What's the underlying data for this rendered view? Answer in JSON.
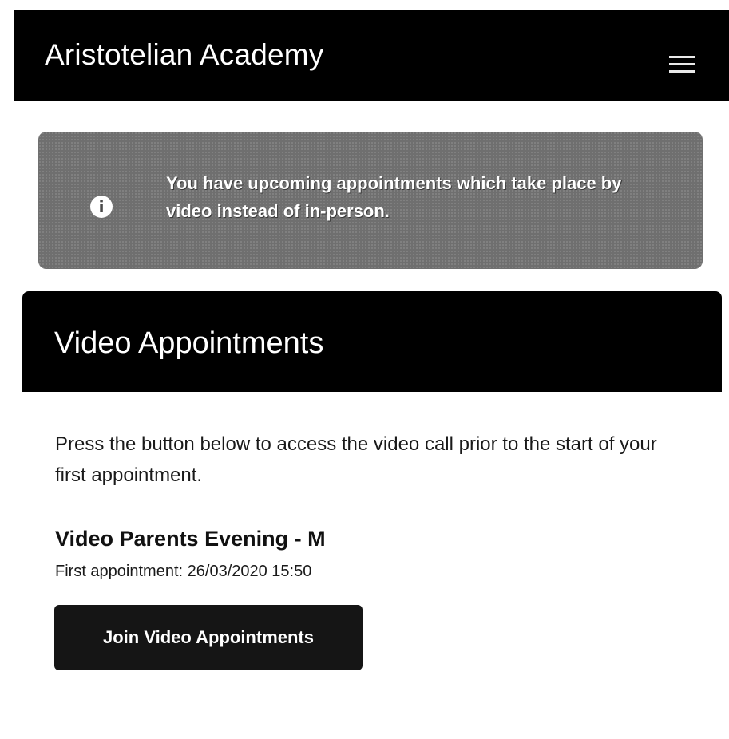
{
  "header": {
    "title": "Aristotelian Academy",
    "menu_icon": "hamburger-menu-icon"
  },
  "alert": {
    "icon": "info-icon",
    "icon_glyph": "i",
    "message": "You have upcoming appointments which take place by video instead of in-person."
  },
  "video_section": {
    "title": "Video Appointments",
    "instructions": "Press the button below to access the video call prior to the start of your first appointment.",
    "event_name": "Video Parents Evening - M",
    "first_appointment_label": "First appointment:",
    "first_appointment_value": "26/03/2020 15:50",
    "join_button_label": "Join Video Appointments"
  },
  "colors": {
    "header_bg": "#000000",
    "alert_bg": "#6f6f6f",
    "button_bg": "#151515",
    "text": "#111111"
  }
}
